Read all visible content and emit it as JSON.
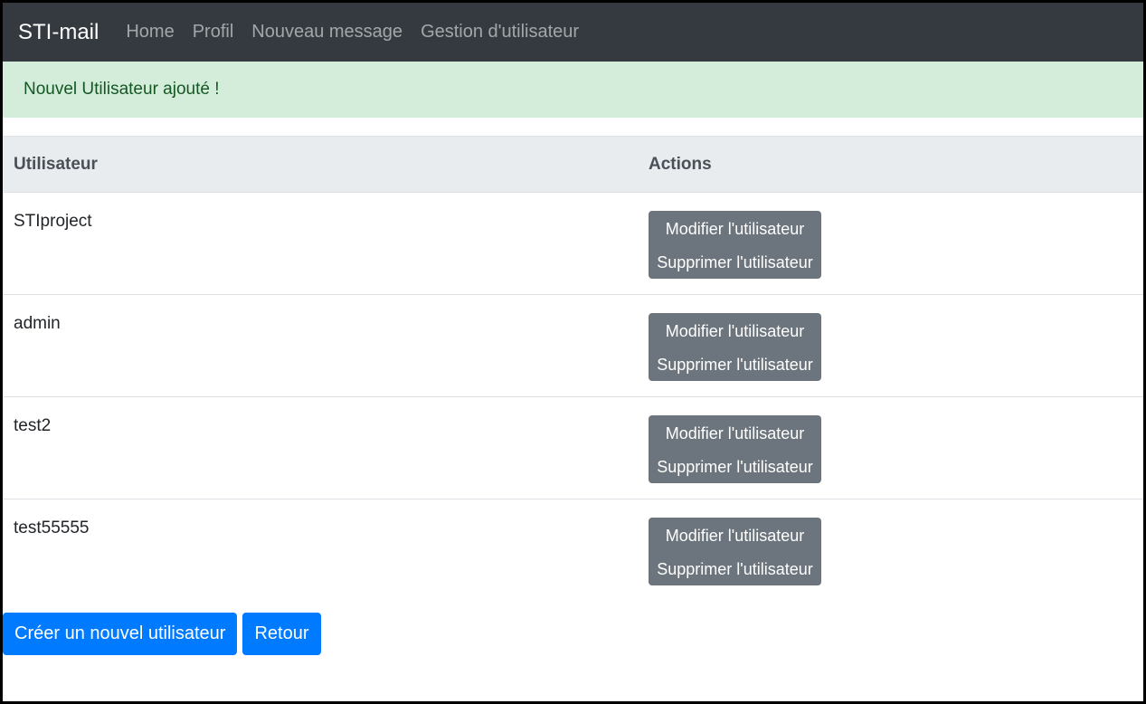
{
  "navbar": {
    "brand": "STI-mail",
    "links": [
      "Home",
      "Profil",
      "Nouveau message",
      "Gestion d'utilisateur"
    ]
  },
  "alert": {
    "message": "Nouvel Utilisateur ajouté !"
  },
  "table": {
    "headers": [
      "Utilisateur",
      "Actions"
    ],
    "rows": [
      {
        "user": "STIproject",
        "edit": "Modifier l'utilisateur",
        "delete": "Supprimer l'utilisateur"
      },
      {
        "user": "admin",
        "edit": "Modifier l'utilisateur",
        "delete": "Supprimer l'utilisateur"
      },
      {
        "user": "test2",
        "edit": "Modifier l'utilisateur",
        "delete": "Supprimer l'utilisateur"
      },
      {
        "user": "test55555",
        "edit": "Modifier l'utilisateur",
        "delete": "Supprimer l'utilisateur"
      }
    ]
  },
  "buttons": {
    "create": "Créer un nouvel utilisateur",
    "back": "Retour"
  },
  "colors": {
    "navbar_bg": "#343a40",
    "alert_bg": "#d4edda",
    "alert_text": "#155724",
    "header_bg": "#e9ecef",
    "action_button_bg": "#6c757d",
    "primary": "#007bff"
  }
}
